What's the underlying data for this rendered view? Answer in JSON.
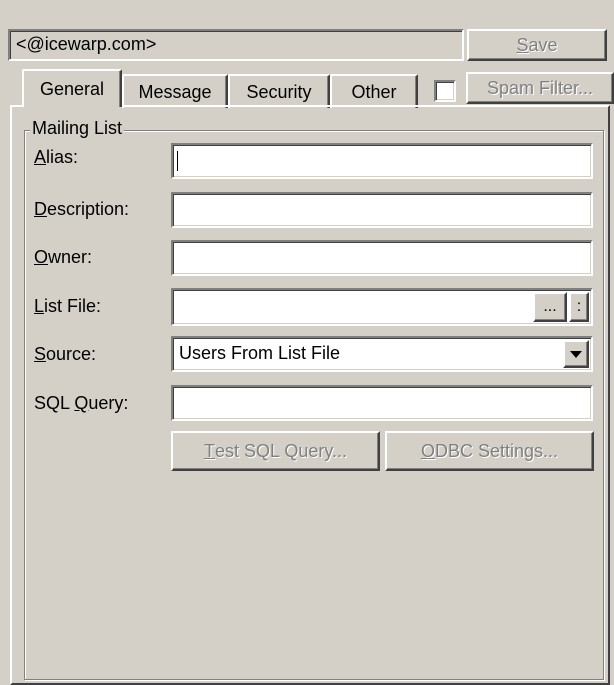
{
  "header": {
    "account": "<@icewarp.com>",
    "save_label": "Save",
    "save_accesskey": "S"
  },
  "tabs": [
    {
      "label": "General",
      "active": true
    },
    {
      "label": "Message",
      "active": false
    },
    {
      "label": "Security",
      "active": false
    },
    {
      "label": "Other",
      "active": false
    }
  ],
  "spam_filter": {
    "label": "Spam Filter...",
    "checked": false
  },
  "group": {
    "title": "Mailing List"
  },
  "fields": {
    "alias": {
      "label_first": "A",
      "label_rest": "lias:",
      "value": ""
    },
    "description": {
      "label_first": "D",
      "label_rest": "escription:",
      "value": ""
    },
    "owner": {
      "label_first": "O",
      "label_rest": "wner:",
      "value": ""
    },
    "list_file": {
      "label_first": "L",
      "label_rest": "ist File:",
      "value": "",
      "browse_label": "...",
      "more_label": ":"
    },
    "source": {
      "label_first": "S",
      "label_rest": "ource:",
      "value": "Users From List File"
    },
    "sql_query": {
      "label_pre": "SQL ",
      "label_first": "Q",
      "label_rest": "uery:",
      "value": ""
    }
  },
  "buttons": {
    "test_sql": {
      "first": "T",
      "rest": "est SQL Query..."
    },
    "odbc": {
      "first": "O",
      "rest": "DBC Settings..."
    }
  }
}
